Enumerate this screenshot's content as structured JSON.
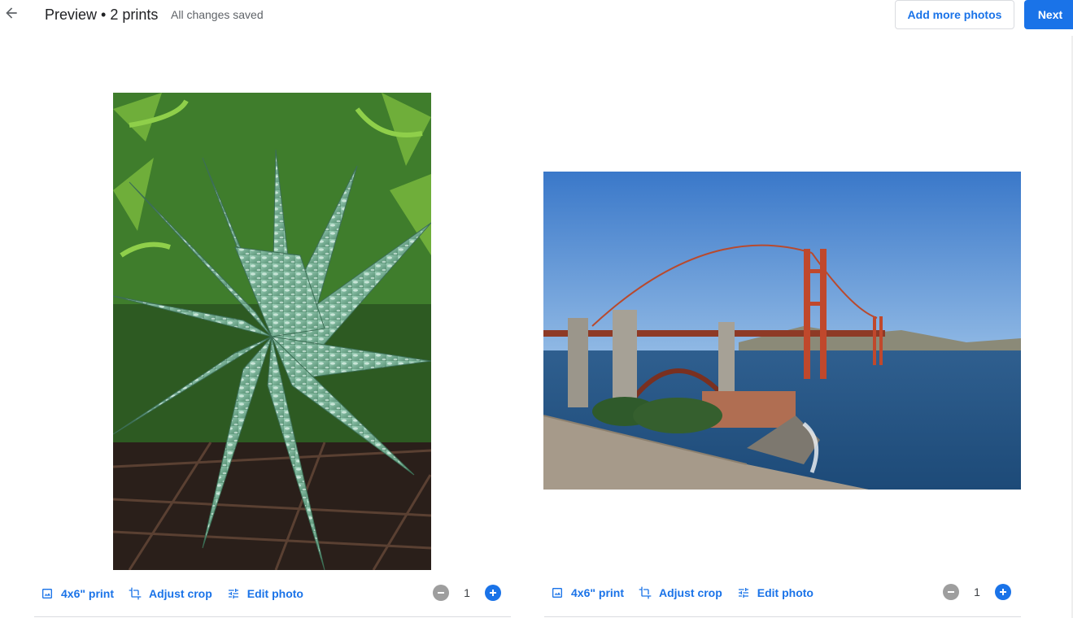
{
  "header": {
    "title": "Preview • 2 prints",
    "status": "All changes saved",
    "add_more_label": "Add more photos",
    "next_label": "Next"
  },
  "prints": [
    {
      "subject": "aloe plant",
      "size_label": "4x6\" print",
      "crop_label": "Adjust crop",
      "edit_label": "Edit photo",
      "quantity": "1"
    },
    {
      "subject": "Golden Gate Bridge",
      "size_label": "4x6\" print",
      "crop_label": "Adjust crop",
      "edit_label": "Edit photo",
      "quantity": "1"
    }
  ],
  "colors": {
    "accent": "#1a73e8",
    "text": "#202124",
    "muted": "#5f6368",
    "disabled": "#9e9e9e"
  },
  "icons": {
    "back": "arrow-back-icon",
    "print_size": "photo-frame-icon",
    "crop": "crop-icon",
    "edit": "sliders-icon",
    "minus": "remove-circle-icon",
    "plus": "add-circle-icon"
  }
}
